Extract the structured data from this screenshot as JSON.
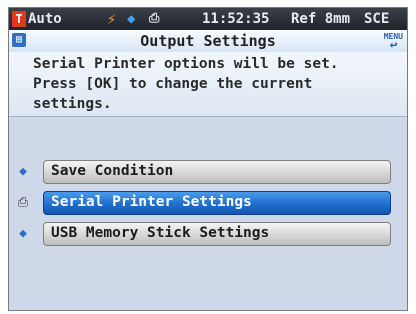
{
  "status_bar": {
    "mode_badge": "T",
    "mode": "Auto",
    "time": "11:52:35",
    "ref_label": "Ref",
    "ref_value": "8mm",
    "sce": "SCE"
  },
  "header": {
    "title": "Output Settings",
    "back_label": "MENU"
  },
  "message": {
    "lines": [
      "Serial Printer options will be set.",
      "Press [OK] to change the current",
      "settings."
    ]
  },
  "menu": {
    "items": [
      {
        "label": "Save Condition",
        "icon": "tag-icon",
        "selected": false
      },
      {
        "label": "Serial Printer Settings",
        "icon": "printer-icon",
        "selected": true
      },
      {
        "label": "USB Memory Stick Settings",
        "icon": "tag-icon",
        "selected": false
      }
    ]
  },
  "colors": {
    "selected": "#1e6fd0",
    "status_bar": "#2a2e36",
    "mode_badge": "#e0391f"
  }
}
